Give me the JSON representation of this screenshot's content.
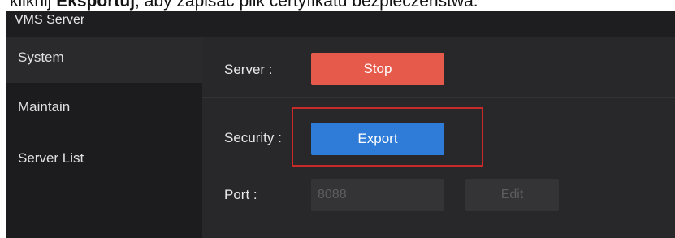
{
  "instruction": {
    "prefix": "kliknij ",
    "bold": "Eksportuj",
    "suffix": ", aby zapisać plik certyfikatu bezpieczeństwa."
  },
  "window": {
    "title": "VMS Server"
  },
  "sidebar": {
    "items": [
      {
        "label": "System",
        "active": true
      },
      {
        "label": "Maintain",
        "active": false
      },
      {
        "label": "Server List",
        "active": false
      }
    ]
  },
  "main": {
    "server": {
      "label": "Server :",
      "button_label": "Stop",
      "button_color": "#e55a4b"
    },
    "security": {
      "label": "Security :",
      "button_label": "Export",
      "button_color": "#2f7bd8",
      "highlight_color": "#c82a2a"
    },
    "port": {
      "label": "Port :",
      "value": "8088",
      "edit_label": "Edit"
    }
  }
}
